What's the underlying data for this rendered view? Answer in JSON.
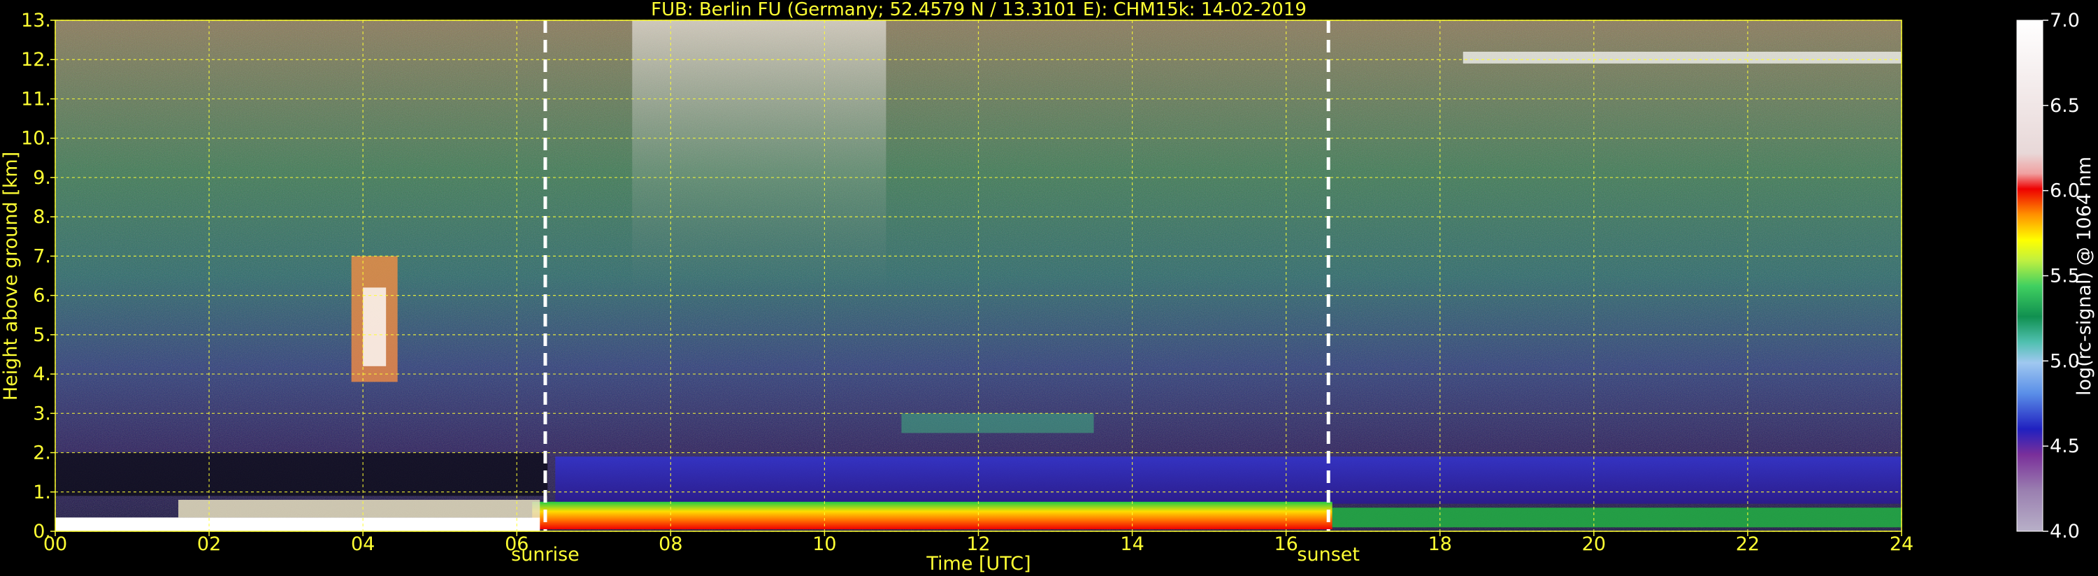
{
  "chart_data": {
    "type": "heatmap",
    "title": "FUB: Berlin FU (Germany; 52.4579 N / 13.3101 E):    CHM15k: 14-02-2019",
    "xlabel": "Time [UTC]",
    "ylabel": "Height above ground [km]",
    "xlim": [
      0,
      24
    ],
    "ylim": [
      0,
      13
    ],
    "x_ticks": [
      "00",
      "02",
      "04",
      "06",
      "08",
      "10",
      "12",
      "14",
      "16",
      "18",
      "20",
      "22",
      "24"
    ],
    "y_ticks": [
      "0.",
      "1.",
      "2.",
      "3.",
      "4.",
      "5.",
      "6.",
      "7.",
      "8.",
      "9.",
      "10.",
      "11.",
      "12.",
      "13."
    ],
    "grid": true,
    "markers": [
      {
        "label": "sunrise",
        "x": 6.37
      },
      {
        "label": "sunset",
        "x": 16.55
      }
    ],
    "colorbar": {
      "label": "log(rc-signal) @ 1064 nm",
      "range": [
        4.0,
        7.0
      ],
      "ticks": [
        "4.0",
        "4.5",
        "5.0",
        "5.5",
        "6.0",
        "6.5",
        "7.0"
      ]
    },
    "colors": {
      "text": "#ffff33",
      "grid": "#ffff33",
      "colorbar_text": "#ffffff",
      "marker_line": "#ffffff"
    }
  }
}
